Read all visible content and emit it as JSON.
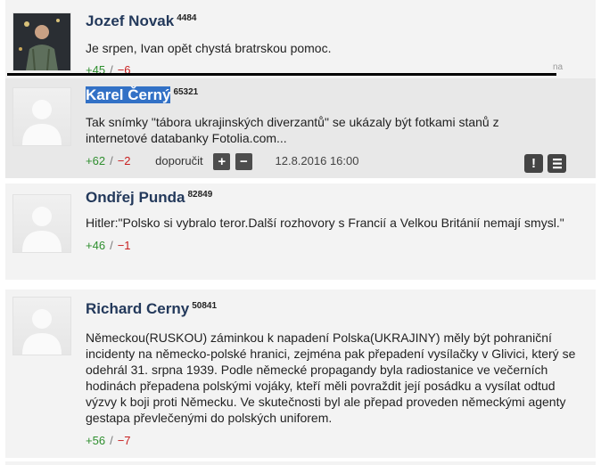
{
  "comments": [
    {
      "author": "Jozef Novak",
      "karma": "4484",
      "text": "Je srpen, Ivan opět chystá bratrskou pomoc.",
      "votes_up": "+45",
      "votes_down": "−6"
    },
    {
      "author": "Karel Černý",
      "karma": "65321",
      "text": "Tak snímky \"tábora ukrajinských diverzantů\" se ukázaly být fotkami stanů z internetové databanky Fotolia.com...",
      "votes_up": "+62",
      "votes_down": "−2",
      "recommend_label": "doporučit",
      "plus_label": "+",
      "minus_label": "−",
      "date": "12.8.2016 16:00",
      "report_label": "!"
    },
    {
      "author": "Ondřej Punda",
      "karma": "82849",
      "text": "Hitler:\"Polsko si vybralo teror.Další rozhovory s Francií a Velkou Británií nemají smysl.\"",
      "votes_up": "+46",
      "votes_down": "−1"
    },
    {
      "author": "Richard Cerny",
      "karma": "50841",
      "text": "Německou(RUSKOU) záminkou k napadení Polska(UKRAJINY) měly být pohraniční incidenty na německo-polské hranici, zejména pak přepadení vysílačky v Glivici, který se odehrál 31. srpna 1939. Podle německé propagandy byla radiostanice ve večerních hodinách přepadena polskými vojáky, kteří měli povraždit její posádku a vysílat odtud výzvy k boji proti Německu. Ve skutečnosti byl ale přepad proveden německými agenty gestapa převlečenými do polských uniforem.",
      "votes_up": "+56",
      "votes_down": "−7"
    }
  ],
  "separator": "/",
  "overflow_fragment": "na",
  "colors": {
    "author": "#23395b",
    "positive": "#2f8f2f",
    "negative": "#c81e1e",
    "selection": "#3271c6"
  }
}
